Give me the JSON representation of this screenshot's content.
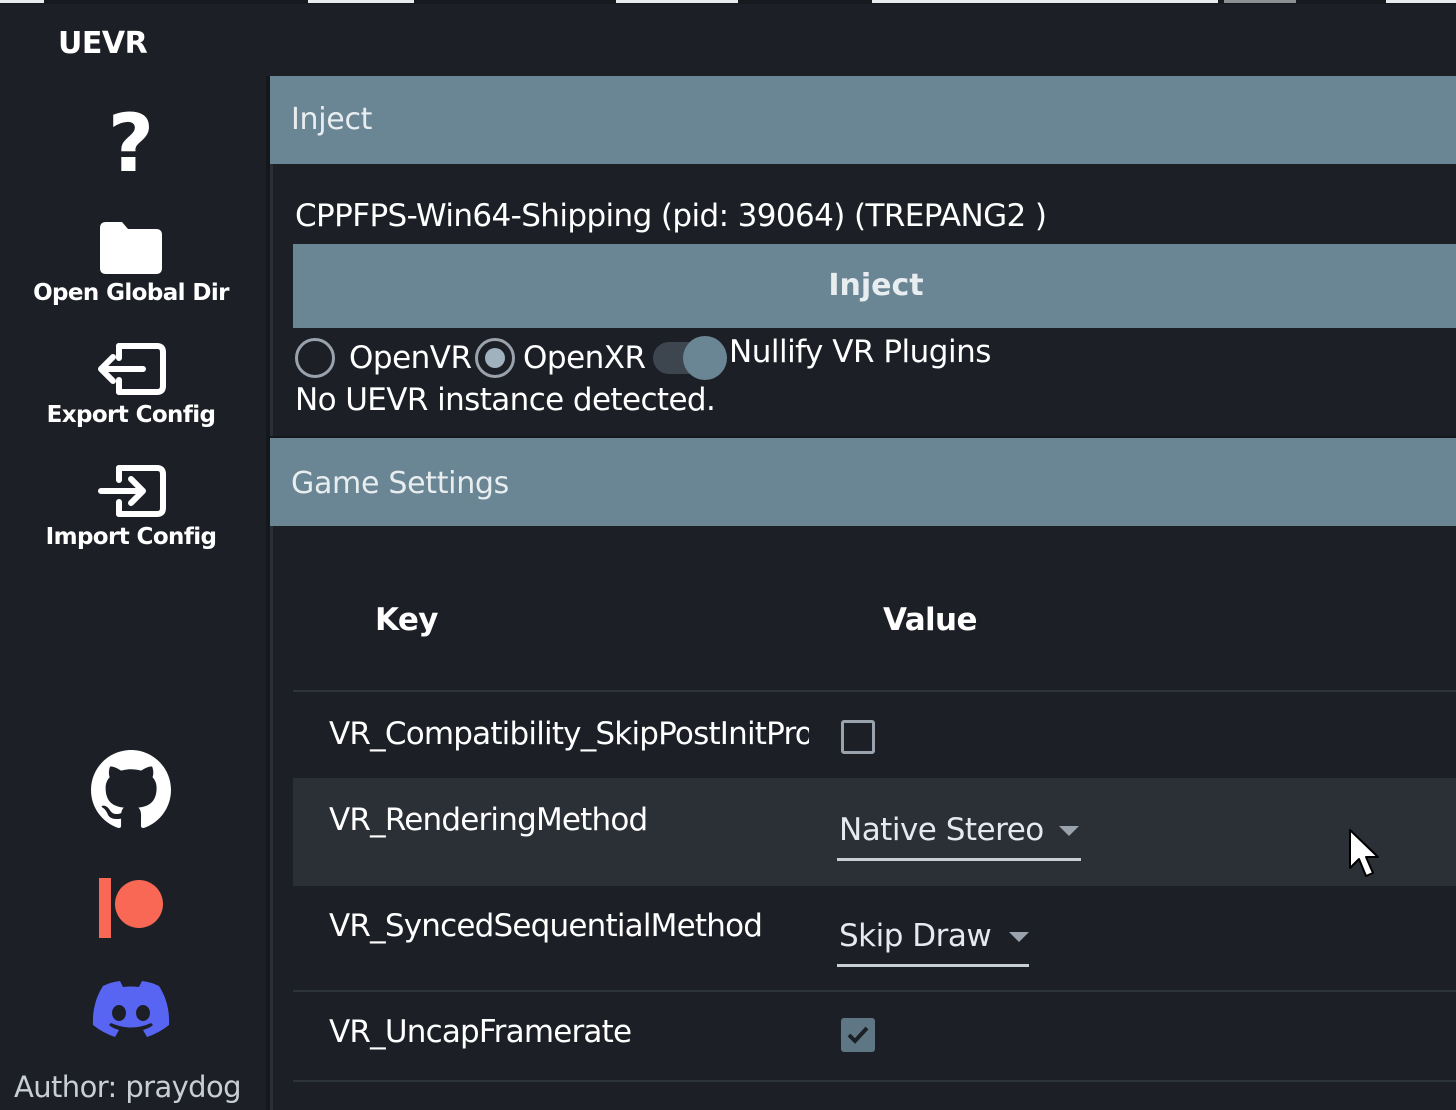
{
  "app": {
    "title": "UEVR"
  },
  "sidebar": {
    "help": {
      "icon": "question-mark-icon",
      "label": "?"
    },
    "open_global_dir": {
      "icon": "folder-icon",
      "label": "Open Global Dir"
    },
    "export_config": {
      "icon": "export-icon",
      "label": "Export Config"
    },
    "import_config": {
      "icon": "import-icon",
      "label": "Import Config"
    },
    "social": [
      {
        "icon": "github-icon"
      },
      {
        "icon": "patreon-icon",
        "color": "#f96854"
      },
      {
        "icon": "discord-icon",
        "color": "#5865f2"
      }
    ],
    "author": "Author: praydog"
  },
  "inject": {
    "header": "Inject",
    "process": "CPPFPS-Win64-Shipping (pid: 39064) (TREPANG2  )",
    "button_label": "Inject",
    "runtime": {
      "options": [
        {
          "label": "OpenVR",
          "selected": false
        },
        {
          "label": "OpenXR",
          "selected": true
        }
      ]
    },
    "nullify": {
      "label": "Nullify VR Plugins",
      "on": true
    },
    "status": "No UEVR instance detected."
  },
  "game_settings": {
    "header": "Game Settings",
    "columns": {
      "key": "Key",
      "value": "Value"
    },
    "rows": [
      {
        "key": "VR_Compatibility_SkipPostInitProperties",
        "type": "checkbox",
        "checked": false
      },
      {
        "key": "VR_RenderingMethod",
        "type": "combo",
        "value": "Native Stereo",
        "highlighted": true
      },
      {
        "key": "VR_SyncedSequentialMethod",
        "type": "combo",
        "value": "Skip Draw"
      },
      {
        "key": "VR_UncapFramerate",
        "type": "checkbox",
        "checked": true
      }
    ]
  },
  "colors": {
    "header_bg": "#6a8593",
    "panel_bg": "#1c2026",
    "accent": "#6a8593"
  }
}
